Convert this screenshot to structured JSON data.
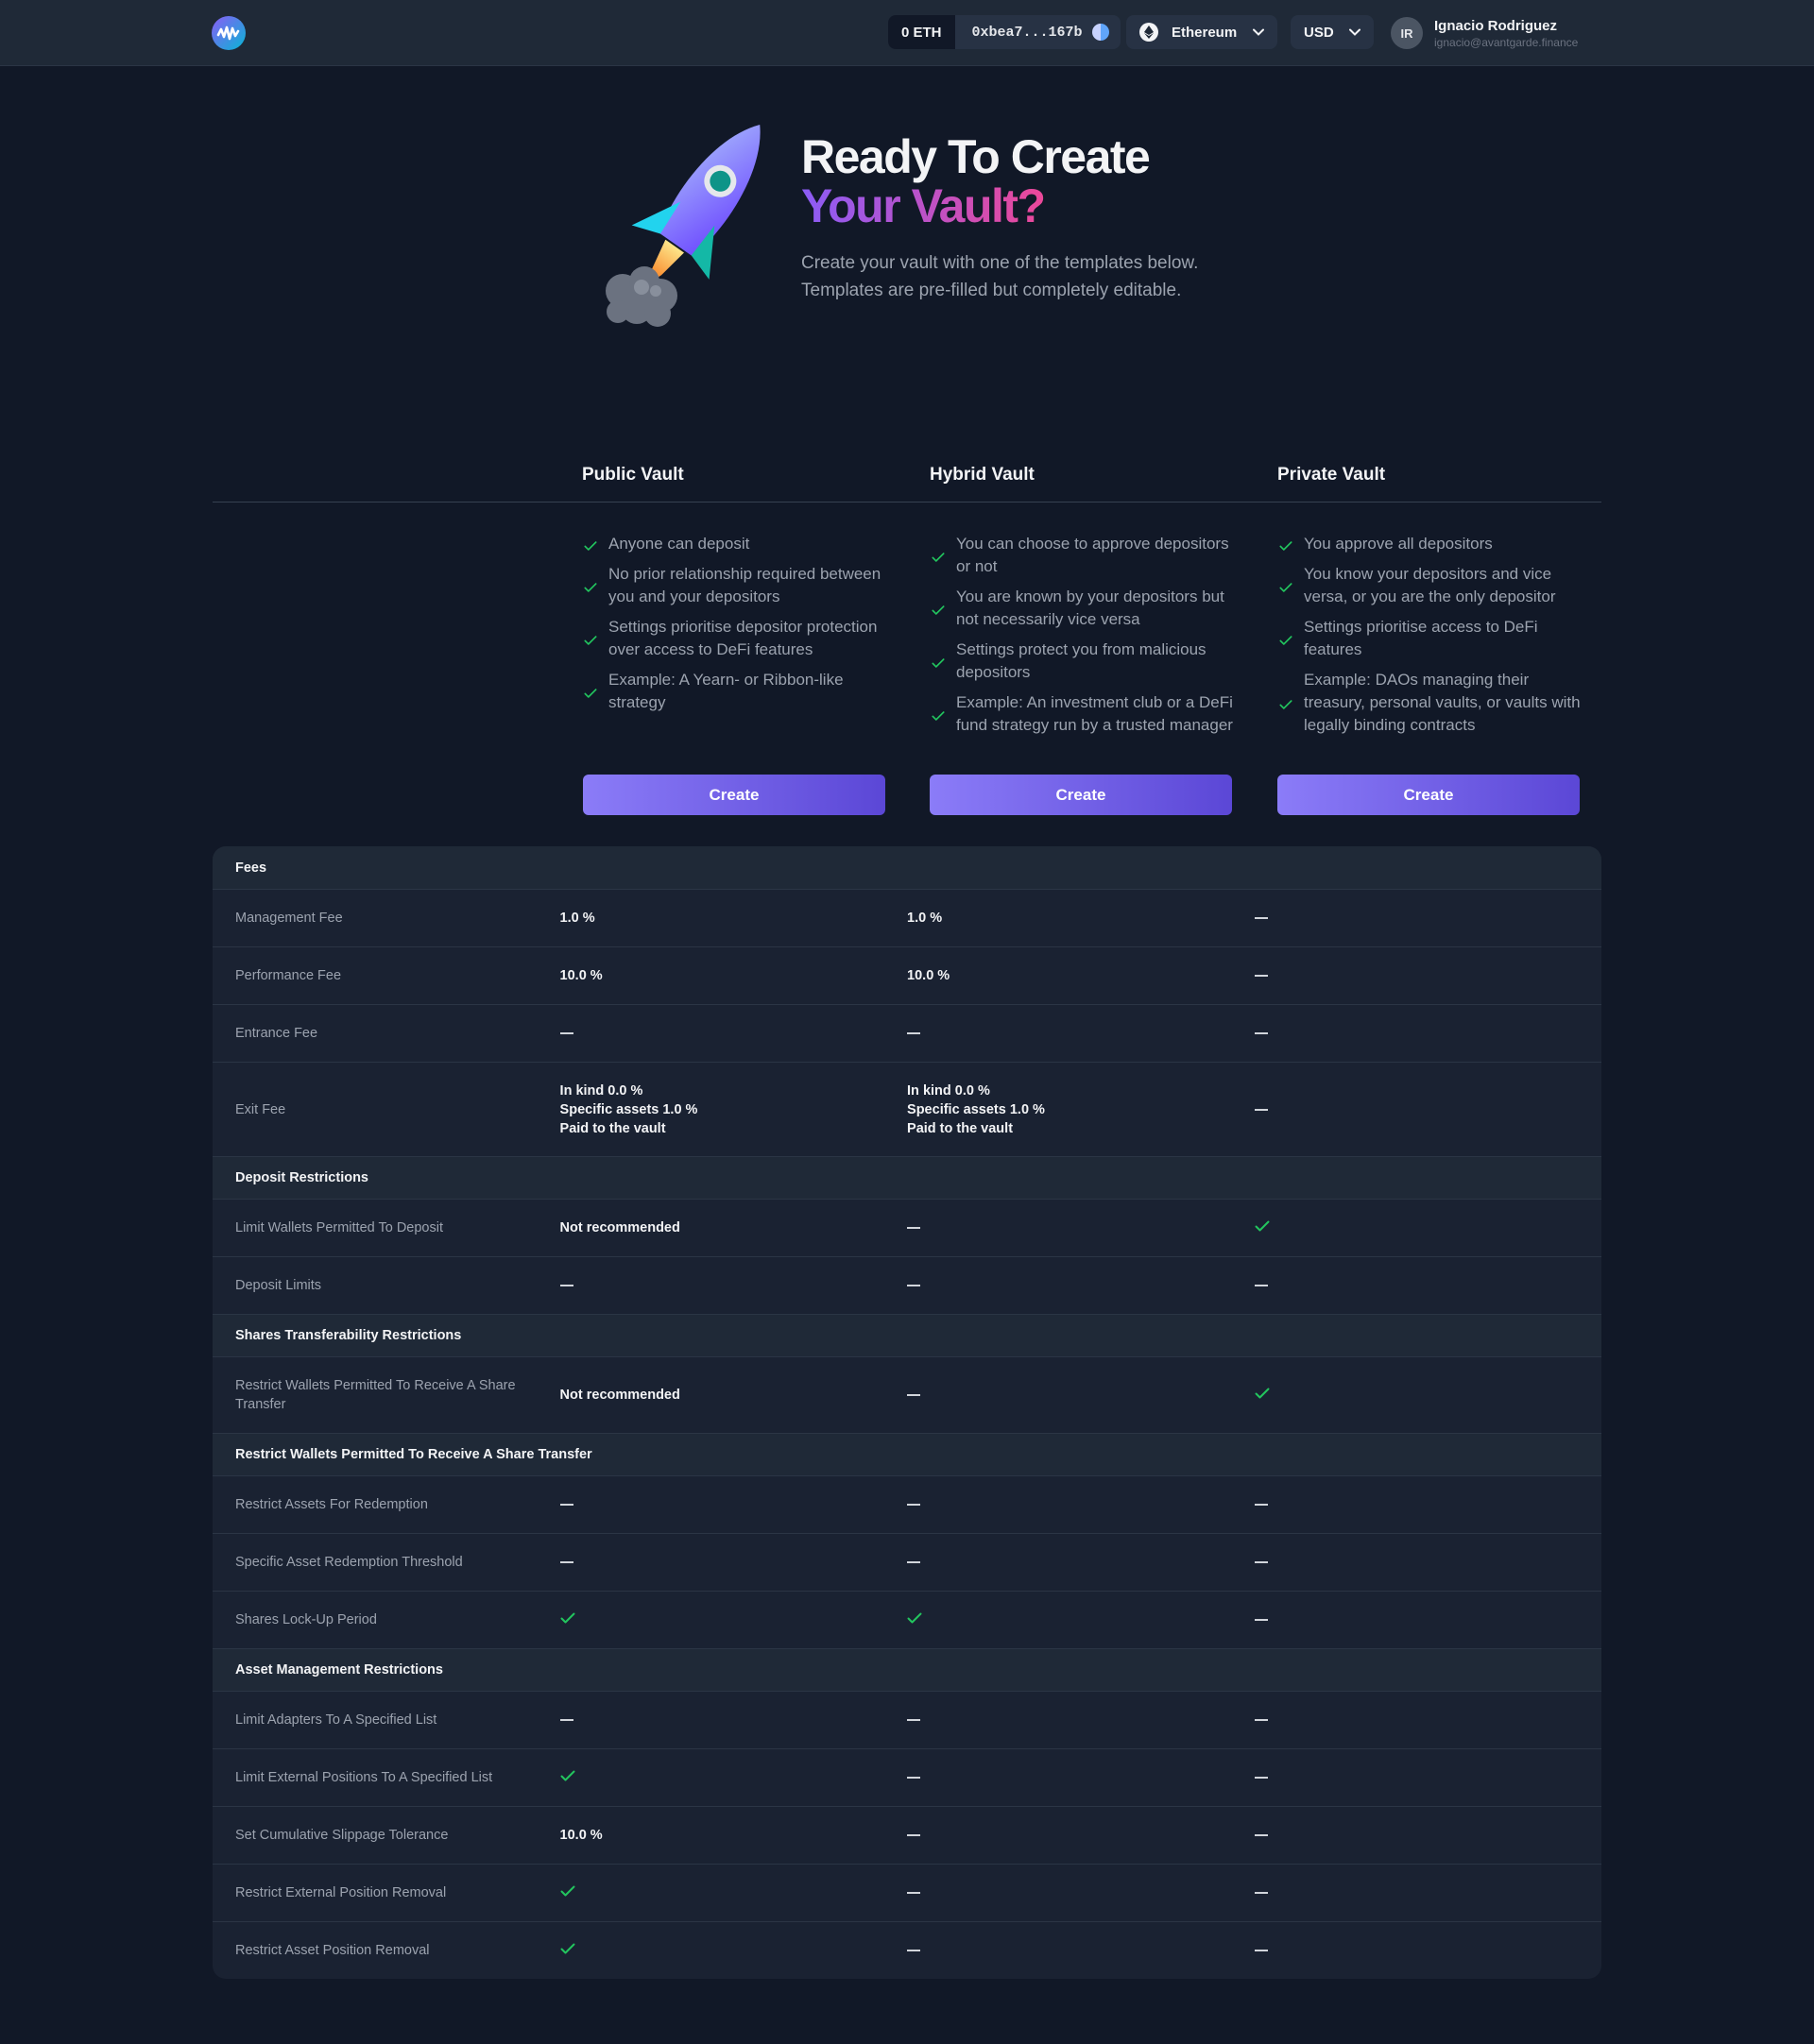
{
  "header": {
    "balance": "0 ETH",
    "address": "0xbea7...167b",
    "network": "Ethereum",
    "currency": "USD",
    "user_initials": "IR",
    "user_name": "Ignacio Rodriguez",
    "user_email": "ignacio@avantgarde.finance"
  },
  "hero": {
    "title_line1": "Ready To Create",
    "title_line2": "Your Vault?",
    "subtitle": "Create your vault with one of the templates below. Templates are pre-filled but completely editable."
  },
  "templates": [
    {
      "name": "Public Vault",
      "features": [
        "Anyone can deposit",
        "No prior relationship required between you and your depositors",
        "Settings prioritise depositor protection over access to DeFi features",
        "Example: A Yearn- or Ribbon-like strategy"
      ],
      "button": "Create"
    },
    {
      "name": "Hybrid Vault",
      "features": [
        "You can choose to approve depositors or not",
        "You are known by your depositors but not necessarily vice versa",
        "Settings protect you from malicious depositors",
        "Example: An investment club or a DeFi fund strategy run by a trusted manager"
      ],
      "button": "Create"
    },
    {
      "name": "Private Vault",
      "features": [
        "You approve all depositors",
        "You know your depositors and vice versa, or you are the only depositor",
        "Settings prioritise access to DeFi features",
        "Example: DAOs managing their treasury, personal vaults, or vaults with legally binding contracts"
      ],
      "button": "Create"
    }
  ],
  "table": {
    "sections": [
      {
        "title": "Fees",
        "rows": [
          {
            "label": "Management Fee",
            "values": [
              "1.0 %",
              "1.0 %",
              "—"
            ]
          },
          {
            "label": "Performance Fee",
            "values": [
              "10.0 %",
              "10.0 %",
              "—"
            ]
          },
          {
            "label": "Entrance Fee",
            "values": [
              "—",
              "—",
              "—"
            ]
          },
          {
            "label": "Exit Fee",
            "values": [
              [
                "In kind 0.0 %",
                "Specific assets 1.0 %",
                "Paid to the vault"
              ],
              [
                "In kind 0.0 %",
                "Specific assets 1.0 %",
                "Paid to the vault"
              ],
              "—"
            ]
          }
        ]
      },
      {
        "title": "Deposit Restrictions",
        "rows": [
          {
            "label": "Limit Wallets Permitted To Deposit",
            "values": [
              "Not recommended",
              "—",
              "check"
            ]
          },
          {
            "label": "Deposit Limits",
            "values": [
              "—",
              "—",
              "—"
            ]
          }
        ]
      },
      {
        "title": "Shares Transferability Restrictions",
        "rows": [
          {
            "label": "Restrict Wallets Permitted To Receive A Share Transfer",
            "values": [
              "Not recommended",
              "—",
              "check"
            ]
          }
        ]
      },
      {
        "title": "Restrict Wallets Permitted To Receive A Share Transfer",
        "rows": [
          {
            "label": "Restrict Assets For Redemption",
            "values": [
              "—",
              "—",
              "—"
            ]
          },
          {
            "label": "Specific Asset Redemption Threshold",
            "values": [
              "—",
              "—",
              "—"
            ]
          },
          {
            "label": "Shares Lock-Up Period",
            "values": [
              "check",
              "check",
              "—"
            ]
          }
        ]
      },
      {
        "title": "Asset Management Restrictions",
        "rows": [
          {
            "label": "Limit Adapters To A Specified List",
            "values": [
              "—",
              "—",
              "—"
            ]
          },
          {
            "label": "Limit External Positions To A Specified List",
            "values": [
              "check",
              "—",
              "—"
            ]
          },
          {
            "label": "Set Cumulative Slippage Tolerance",
            "values": [
              "10.0 %",
              "—",
              "—"
            ]
          },
          {
            "label": "Restrict External Position Removal",
            "values": [
              "check",
              "—",
              "—"
            ]
          },
          {
            "label": "Restrict Asset Position Removal",
            "values": [
              "check",
              "—",
              "—"
            ]
          }
        ]
      }
    ]
  },
  "colors": {
    "background": "#111827",
    "accent_purple": "#8b5cf6",
    "accent_pink": "#ec4899",
    "check_green": "#22c55e"
  },
  "icons": {
    "logo": "waveform-logo-icon",
    "wallet": "address-identicon-icon",
    "network": "ethereum-icon",
    "dropdown": "chevron-down-icon",
    "feature_bullet": "check-icon",
    "hero": "rocket-illustration"
  }
}
